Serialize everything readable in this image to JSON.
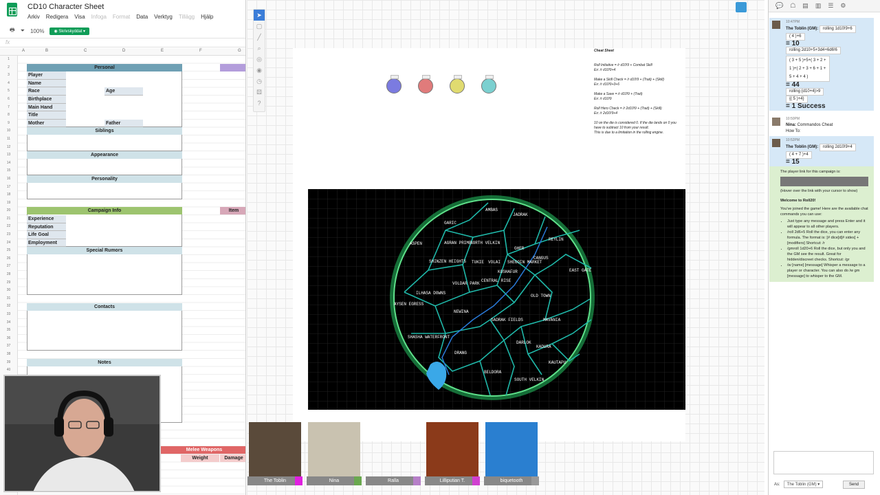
{
  "sheets": {
    "title": "CD10 Character Sheet",
    "menu": [
      "Arkiv",
      "Redigera",
      "Visa",
      "Infoga",
      "Format",
      "Data",
      "Verktyg",
      "Tillägg",
      "Hjälp"
    ],
    "menu_dim": [
      false,
      false,
      false,
      true,
      true,
      false,
      false,
      true,
      false
    ],
    "zoom": "100%",
    "share_label": "Skrivskyddat",
    "fx": "fx",
    "columns": [
      "A",
      "B",
      "C",
      "D",
      "E",
      "F",
      "G"
    ],
    "rows": [
      "1",
      "2",
      "3",
      "4",
      "5",
      "6",
      "7",
      "8",
      "9",
      "10",
      "11",
      "12",
      "13",
      "14",
      "15",
      "16",
      "17",
      "18",
      "19",
      "20",
      "21",
      "22",
      "23",
      "24",
      "25",
      "26",
      "27",
      "28",
      "29",
      "30",
      "31",
      "32",
      "33",
      "34",
      "35",
      "36",
      "37",
      "38",
      "39",
      "40"
    ],
    "personal": "Personal",
    "fields": [
      "Player",
      "Name",
      "Race",
      "Birthplace",
      "Main Hand",
      "Title",
      "Mother"
    ],
    "age": "Age",
    "father": "Father",
    "siblings": "Siblings",
    "appearance": "Appearance",
    "personality": "Personality",
    "campaign": "Campaign Info",
    "campaign_fields": [
      "Experience",
      "Reputation",
      "Life Goal",
      "Employment"
    ],
    "rumors": "Special Rumors",
    "contacts": "Contacts",
    "notes": "Notes",
    "item": "Item",
    "melee": "Melee Weapons",
    "weight": "Weight",
    "damage": "Damage",
    "colors": {
      "personal": "#6fa0b4",
      "campaign": "#9dc46f",
      "purple": "#b39ddb",
      "pink": "#d7a7b8",
      "red": "#e06666",
      "pale": "#cfe2e8"
    }
  },
  "cheat": {
    "title": "Cheat Sheet",
    "lines": [
      "Roll Initiative = /r d10!9 + Combat Skill",
      "Ex: /r d10!9+4",
      "Make a Skill Check = /r d10!9 + (Trait) + (Skill)",
      "Ex: /r d10!9+3+6",
      "Make a Save = /r d10!9 + (Trait)",
      "Ex: /r d10!9",
      "Roll Hero Check = /r 2d10!9 + (Trait) + (Skill)",
      "Ex: /r 2d10!9+4",
      "10 on the die is considered 0. If the die lands on 0 you have to subtract 10 from your result.",
      "This is due to a limitation in the rolling engine."
    ]
  },
  "tokens": [
    {
      "color": "#7b7be0"
    },
    {
      "color": "#e07b7b"
    },
    {
      "color": "#e0db70"
    },
    {
      "color": "#7bd0d0"
    }
  ],
  "map": {
    "places": [
      "AMBAS",
      "JADRAK",
      "GARIC",
      "REYLIN",
      "ASPEN",
      "AGRAN PRIME",
      "NORTH VELKIN",
      "GHER",
      "CANGUS",
      "SHINZEN HEIGHTS",
      "TUKIE",
      "VOLAI",
      "SHEGOIN MARKET",
      "EAST GATE",
      "KOSHAFUR",
      "VOLDAR PARK",
      "CENTRAL RISE",
      "ILHASA DOWNS",
      "OLD TOWN",
      "AYSEN EGRESS",
      "NEWINA",
      "SADRAK FIELDS",
      "MAVANIA",
      "SHASHA WATERFRONT",
      "DARLOK",
      "KADURA",
      "DRANG",
      "KAUTAPU",
      "BELDORA",
      "SOUTH VELKIN"
    ]
  },
  "players": [
    {
      "name": "The Toblin",
      "color": "#e020e0"
    },
    {
      "name": "Nina",
      "color": "#6aa84f"
    },
    {
      "name": "Ralla",
      "color": "#b67fc8"
    },
    {
      "name": "Lilliputian T.",
      "color": "#d040d0"
    },
    {
      "name": "biquetooth",
      "color": "#999999"
    }
  ],
  "chat": {
    "time1": "10:47PM",
    "who_gm": "The Toblin (GM):",
    "roll1": "rolling 1d10!9+6",
    "expr1": "( 4 )+6",
    "res1": "= 10",
    "roll2": "rolling 2d10+5+3d4+6d6!6",
    "expr2a": "( 3 + 5 )+5+( 3 + 2 +",
    "expr2b": "1 )+( 2 + 3 + 6 + 1 +",
    "expr2c": "5 + 4 + 4 )",
    "res2": "= 44",
    "roll3": "rolling {d10+4}>9",
    "expr3": "{( 5 )+4}",
    "res3": "= 1 Success",
    "time2": "10:50PM",
    "nina": "Nina:",
    "nina_msg": "Commandos Cheat",
    "howto": "How To:",
    "time3": "10:52PM",
    "roll4": "rolling 2d10!9+4",
    "expr4": "( 4 + 7 )+4",
    "res4": "= 15",
    "link_label": "The player link for this campaign is:",
    "hover": "(Hover over the link with your cursor to show)",
    "welcome": "Welcome to Roll20!",
    "intro": "You've joined the game! Here are the available chat commands you can use:",
    "b1": "Just type any message and press Enter and it will appear to all other players.",
    "b2": "/roll 2d6+5 Roll the dice, you can enter any formula. The format is: [# dice]d[# sides] + [modifiers] Shortcut: /r",
    "b3": "/gmroll 1d20+6 Roll the dice, but only you and the GM see the result. Great for hidden/discreet checks. Shortcut: /gr",
    "b4": "/w [name] [message] Whisper a message to a player or character. You can also do /w gm [message] to whisper to the GM.",
    "as": "As:",
    "as_who": "The Toblin (GM)",
    "send": "Send"
  }
}
